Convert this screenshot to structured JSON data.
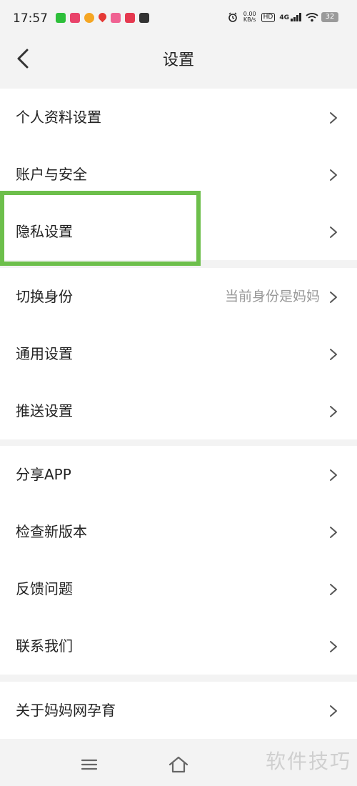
{
  "status_bar": {
    "time": "17:57",
    "net_speed_value": "0.00",
    "net_speed_unit": "KB/s",
    "hd_label": "HD",
    "network_type": "4G",
    "battery": "32",
    "notification_icons": [
      "wechat-icon",
      "instagram-icon",
      "weibo-icon",
      "pin-icon",
      "app-icon",
      "heart-app-icon",
      "k-app-icon"
    ],
    "colors": {
      "wechat": "#2dbf3a",
      "instagram": "#e9436a",
      "weibo": "#f5a623",
      "pin": "#e53935",
      "app": "#f06292",
      "heart": "#e53950",
      "k": "#333333"
    }
  },
  "header": {
    "title": "设置"
  },
  "groups": [
    {
      "items": [
        {
          "label": "个人资料设置"
        },
        {
          "label": "账户与安全"
        },
        {
          "label": "隐私设置"
        }
      ]
    },
    {
      "items": [
        {
          "label": "切换身份",
          "value": "当前身份是妈妈"
        },
        {
          "label": "通用设置"
        },
        {
          "label": "推送设置"
        }
      ]
    },
    {
      "items": [
        {
          "label": "分享APP"
        },
        {
          "label": "检查新版本"
        },
        {
          "label": "反馈问题"
        },
        {
          "label": "联系我们"
        }
      ]
    },
    {
      "items": [
        {
          "label": "关于妈妈网孕育"
        }
      ]
    }
  ],
  "watermark": "软件技巧",
  "highlight_color": "#6dbf4b"
}
